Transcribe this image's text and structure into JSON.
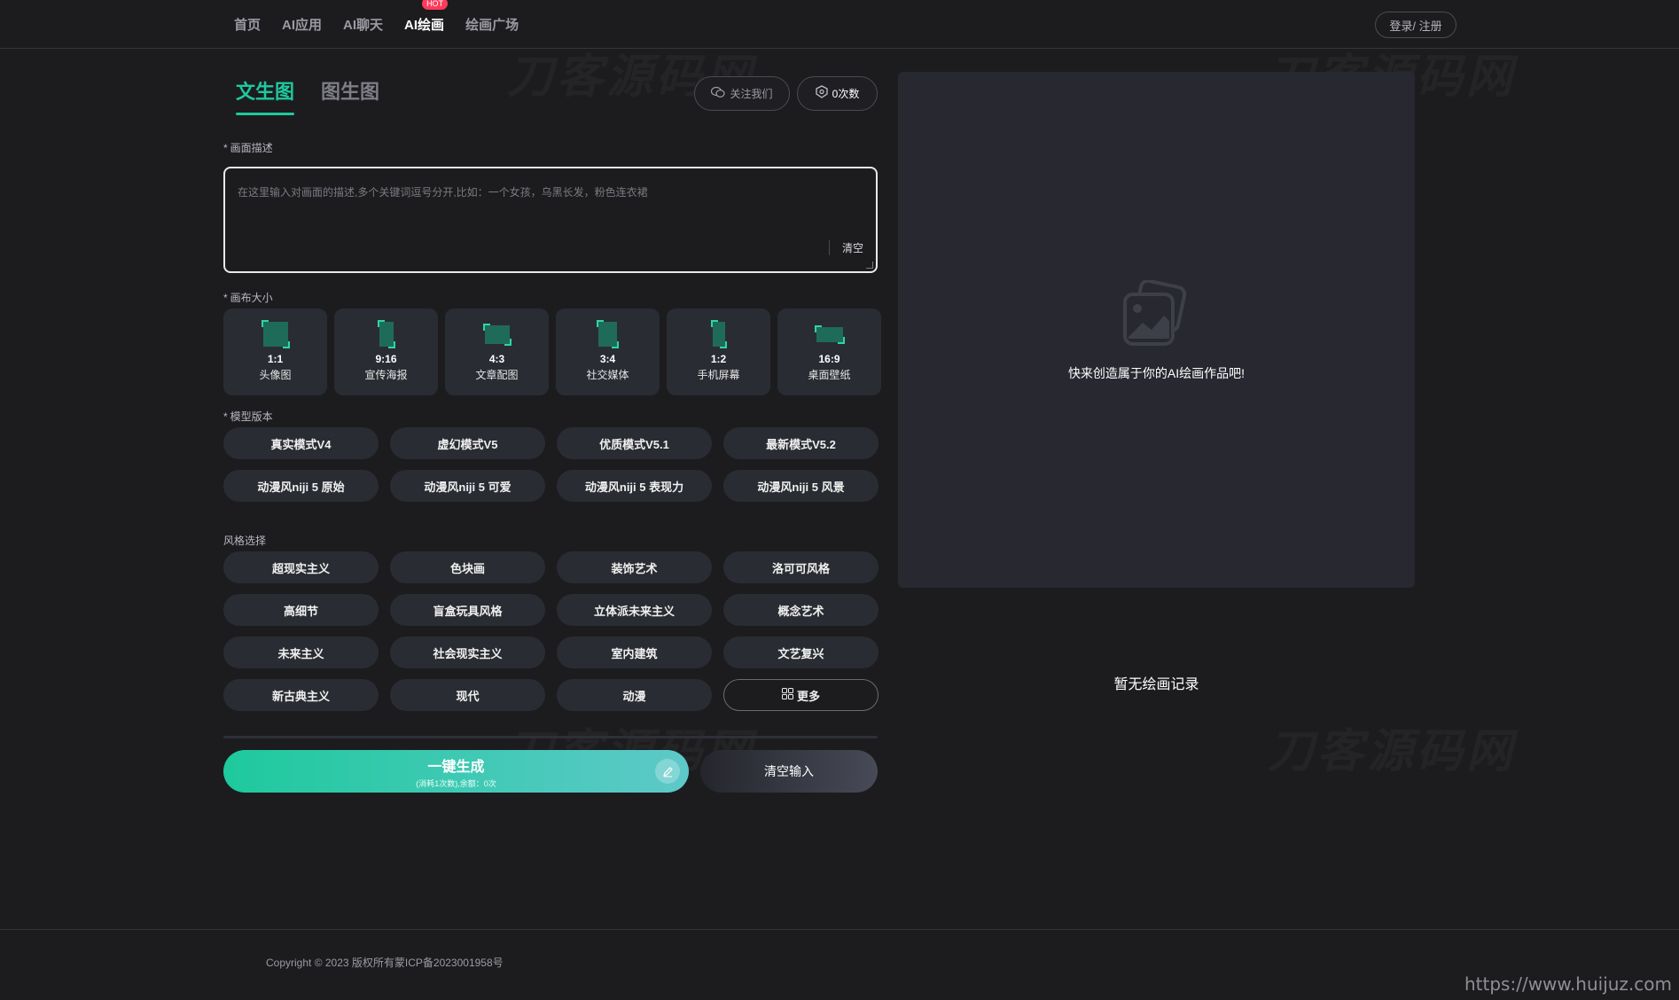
{
  "nav": {
    "items": [
      "首页",
      "AI应用",
      "AI聊天",
      "AI绘画",
      "绘画广场"
    ],
    "active_index": 3,
    "hot_badge": "HOT",
    "login": "登录/ 注册"
  },
  "watermark": "刀客源码网",
  "tabs": [
    "文生图",
    "图生图"
  ],
  "follow_btn": "关注我们",
  "count_btn": "0次数",
  "prompt": {
    "label": "画面描述",
    "placeholder": "在这里输入对画面的描述,多个关键词逗号分开,比如：一个女孩，乌黑长发，粉色连衣裙",
    "clear": "清空"
  },
  "canvas": {
    "label": "画布大小",
    "sizes": [
      {
        "ratio": "1:1",
        "name": "头像图"
      },
      {
        "ratio": "9:16",
        "name": "宣传海报"
      },
      {
        "ratio": "4:3",
        "name": "文章配图"
      },
      {
        "ratio": "3:4",
        "name": "社交媒体"
      },
      {
        "ratio": "1:2",
        "name": "手机屏幕"
      },
      {
        "ratio": "16:9",
        "name": "桌面壁纸"
      }
    ]
  },
  "model": {
    "label": "模型版本",
    "options": [
      "真实模式V4",
      "虚幻模式V5",
      "优质模式V5.1",
      "最新模式V5.2",
      "动漫风niji 5 原始",
      "动漫风niji 5 可爱",
      "动漫风niji 5 表现力",
      "动漫风niji 5 风景"
    ]
  },
  "style": {
    "label": "风格选择",
    "options": [
      "超现实主义",
      "色块画",
      "装饰艺术",
      "洛可可风格",
      "高细节",
      "盲盒玩具风格",
      "立体派未来主义",
      "概念艺术",
      "未来主义",
      "社会现实主义",
      "室内建筑",
      "文艺复兴",
      "新古典主义",
      "现代",
      "动漫"
    ],
    "more": "更多"
  },
  "generate": {
    "label": "一键生成",
    "sub": "(消耗1次数),余额：0次"
  },
  "reset": "清空输入",
  "preview": {
    "hint": "快来创造属于你的AI绘画作品吧!",
    "no_record": "暂无绘画记录"
  },
  "footer": {
    "copyright": "Copyright © 2023 版权所有蒙ICP备2023001958号",
    "url": "https://www.huijuz.com"
  },
  "colors": {
    "accent": "#1ec99d",
    "background": "#1c1c1f",
    "card": "#2a2c33",
    "hot": "#ff3b5c"
  }
}
